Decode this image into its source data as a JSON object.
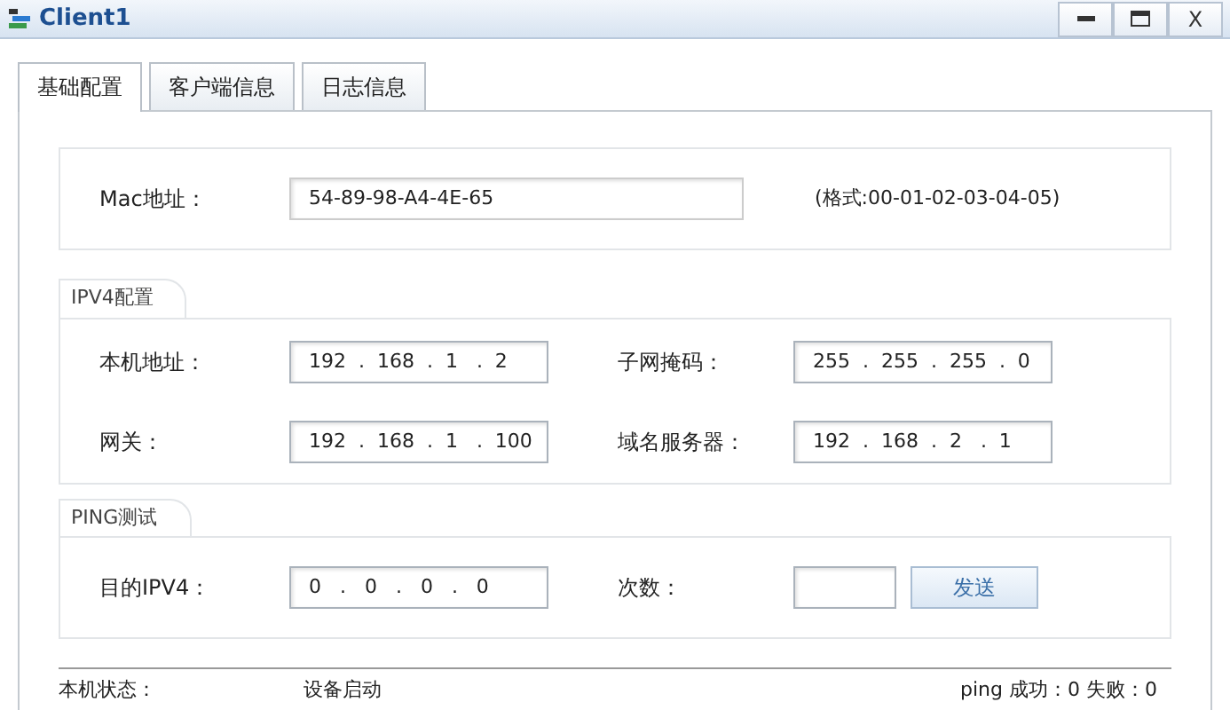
{
  "window": {
    "title": "Client1",
    "close_label": "X"
  },
  "tabs": [
    {
      "label": "基础配置",
      "selected": true
    },
    {
      "label": "客户端信息",
      "selected": false
    },
    {
      "label": "日志信息",
      "selected": false
    }
  ],
  "mac": {
    "label": "Mac地址：",
    "value": "54-89-98-A4-4E-65",
    "hint": "(格式:00-01-02-03-04-05)"
  },
  "ipv4": {
    "title": "IPV4配置",
    "fields": [
      {
        "label": "本机地址：",
        "value": "192  .  168  .  1   .  2"
      },
      {
        "label": "子网掩码：",
        "value": "255  .  255  .  255  .  0"
      },
      {
        "label": "网关：",
        "value": "192  .  168  .  1   .  100"
      },
      {
        "label": "域名服务器：",
        "value": "192  .  168  .  2   .  1"
      }
    ]
  },
  "ping": {
    "title": "PING测试",
    "target_label": "目的IPV4：",
    "target_value": "0   .   0   .   0   .   0",
    "count_label": "次数：",
    "send_button": "发送"
  },
  "status": {
    "label": "本机状态：",
    "value": "设备启动",
    "ping_result": "ping 成功：0 失败：0"
  }
}
